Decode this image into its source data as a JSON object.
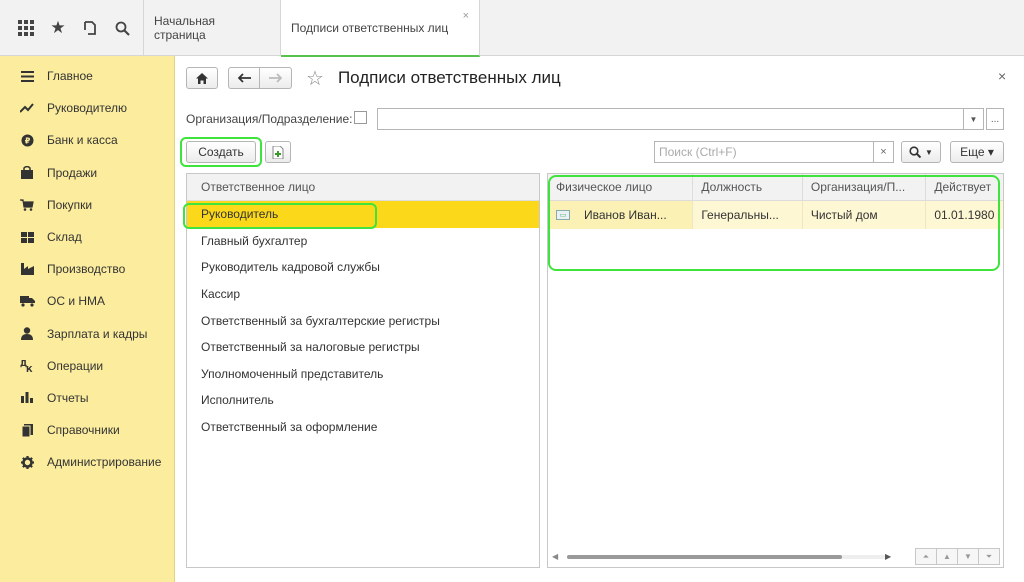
{
  "topbar": {
    "icons": [
      "apps-grid-icon",
      "star-icon",
      "history-icon",
      "search-icon"
    ],
    "tabs": [
      {
        "label": "Начальная страница"
      },
      {
        "label": "Подписи ответственных лиц",
        "close": "×"
      }
    ]
  },
  "sidebar": {
    "items": [
      {
        "label": "Главное",
        "icon": "menu-icon"
      },
      {
        "label": "Руководителю",
        "icon": "trend-icon"
      },
      {
        "label": "Банк и касса",
        "icon": "coin-icon"
      },
      {
        "label": "Продажи",
        "icon": "bag-icon"
      },
      {
        "label": "Покупки",
        "icon": "cart-icon"
      },
      {
        "label": "Склад",
        "icon": "warehouse-icon"
      },
      {
        "label": "Производство",
        "icon": "factory-icon"
      },
      {
        "label": "ОС и НМА",
        "icon": "truck-icon"
      },
      {
        "label": "Зарплата и кадры",
        "icon": "person-icon"
      },
      {
        "label": "Операции",
        "icon": "operations-icon"
      },
      {
        "label": "Отчеты",
        "icon": "bar-chart-icon"
      },
      {
        "label": "Справочники",
        "icon": "book-icon"
      },
      {
        "label": "Администрирование",
        "icon": "gear-icon"
      }
    ]
  },
  "form": {
    "title": "Подписи ответственных лиц",
    "close": "×",
    "org_label": "Организация/Подразделение:",
    "org_value": "",
    "org_more": "...",
    "create_label": "Создать",
    "search_placeholder": "Поиск (Ctrl+F)",
    "search_clear": "×",
    "more_label": "Еще ▾"
  },
  "left_list": {
    "header": "Ответственное лицо",
    "items": [
      "Руководитель",
      "Главный бухгалтер",
      "Руководитель кадровой службы",
      "Кассир",
      "Ответственный за бухгалтерские регистры",
      "Ответственный за налоговые регистры",
      "Уполномоченный представитель",
      "Исполнитель",
      "Ответственный за оформление"
    ],
    "selected_index": 0
  },
  "right_table": {
    "columns": [
      "Физическое лицо",
      "Должность",
      "Организация/П...",
      "Действует"
    ],
    "rows": [
      [
        "Иванов Иван...",
        "Генеральны...",
        "Чистый дом",
        "01.01.1980"
      ]
    ]
  },
  "accent_colors": {
    "sidebar": "#fbec9e",
    "selection": "#fbd819",
    "active_tab": "#58c24f",
    "highlight_ring": "#3ee33e"
  }
}
